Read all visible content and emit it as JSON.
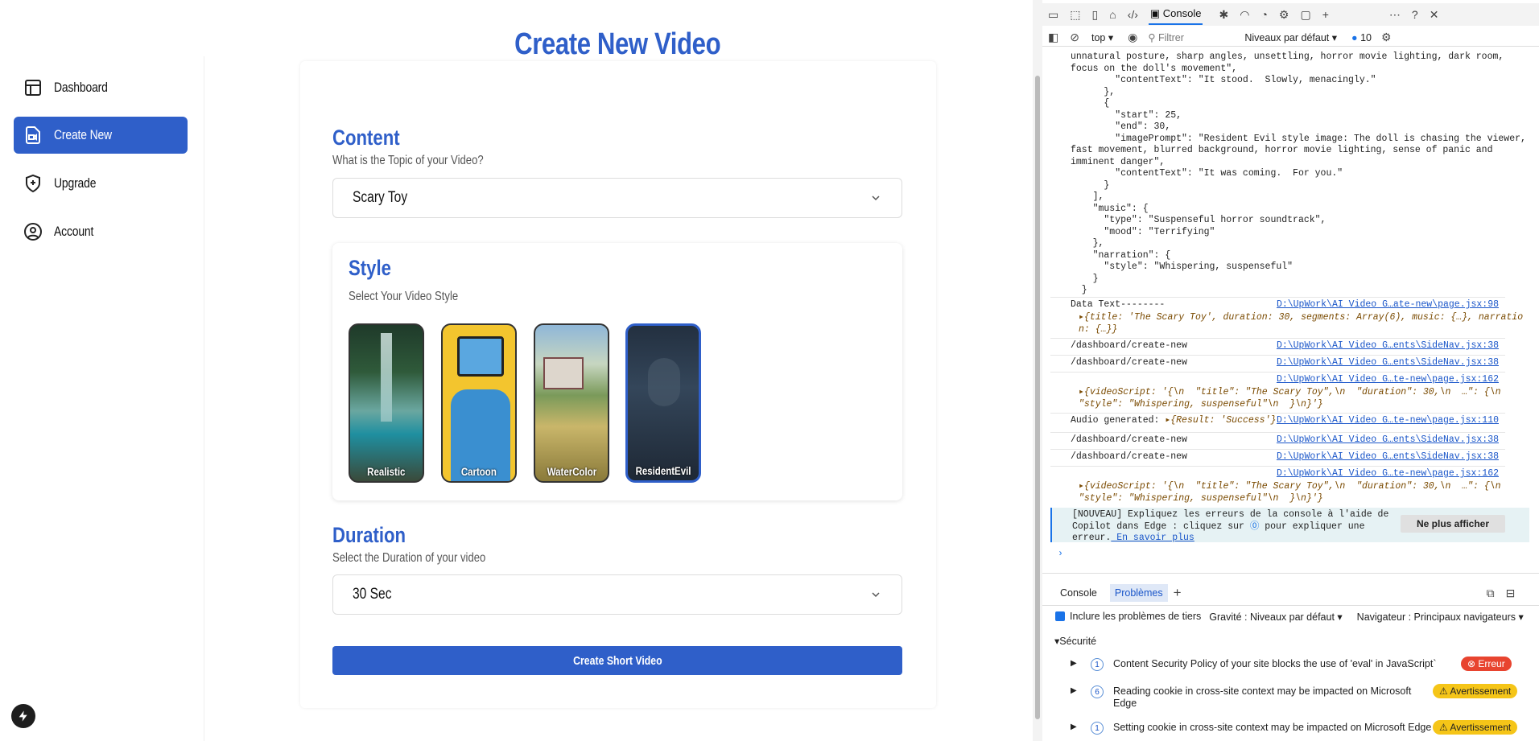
{
  "sidebar": {
    "items": [
      {
        "label": "Dashboard",
        "icon": "layout-icon"
      },
      {
        "label": "Create New",
        "icon": "file-video-icon"
      },
      {
        "label": "Upgrade",
        "icon": "shield-plus-icon"
      },
      {
        "label": "Account",
        "icon": "user-circle-icon"
      }
    ]
  },
  "page": {
    "title": "Create New Video",
    "content_heading": "Content",
    "content_sub": "What is the Topic of your Video?",
    "topic_value": "Scary Toy",
    "style_heading": "Style",
    "style_sub": "Select Your Video Style",
    "styles": [
      {
        "label": "Realistic"
      },
      {
        "label": "Cartoon"
      },
      {
        "label": "WaterColor"
      },
      {
        "label": "ResidentEvil"
      }
    ],
    "duration_heading": "Duration",
    "duration_sub": "Select the Duration of your video",
    "duration_value": "30 Sec",
    "create_button": "Create Short Video"
  },
  "devtools": {
    "tabs": {
      "console": "Console"
    },
    "toolbar": {
      "context": "top",
      "filter_placeholder": "Filtrer",
      "levels": "Niveaux par défaut",
      "issue_count": "10"
    },
    "code_lines": [
      "unnatural posture, sharp angles, unsettling, horror movie lighting, dark room,",
      "focus on the doll's movement\",",
      "        \"contentText\": \"It stood.  Slowly, menacingly.\"",
      "      },",
      "      {",
      "        \"start\": 25,",
      "        \"end\": 30,",
      "        \"imagePrompt\": \"Resident Evil style image: The doll is chasing the viewer,",
      "fast movement, blurred background, horror movie lighting, sense of panic and",
      "imminent danger\",",
      "        \"contentText\": \"It was coming.  For you.\"",
      "      }",
      "    ],",
      "    \"music\": {",
      "      \"type\": \"Suspenseful horror soundtrack\",",
      "      \"mood\": \"Terrifying\"",
      "    },",
      "    \"narration\": {",
      "      \"style\": \"Whispering, suspenseful\"",
      "    }",
      "  }"
    ],
    "logs": [
      {
        "text": "Data Text--------",
        "link": "D:\\UpWork\\AI Video G…ate-new\\page.jsx:98"
      },
      {
        "text": "{title: 'The Scary Toy', duration: 30, segments: Array(6), music: {…}, narratio",
        "text2": "n: {…}}"
      },
      {
        "text": "/dashboard/create-new",
        "link": "D:\\UpWork\\AI Video G…ents\\SideNav.jsx:38"
      },
      {
        "text": "/dashboard/create-new",
        "link": "D:\\UpWork\\AI Video G…ents\\SideNav.jsx:38"
      },
      {
        "link": "D:\\UpWork\\AI Video G…te-new\\page.jsx:162"
      },
      {
        "text": "{videoScript: '{\\n  \"title\": \"The Scary Toy\",\\n  \"duration\": 30,\\n  …\": {\\n",
        "text2": "\"style\": \"Whispering, suspenseful\"\\n  }\\n}'}"
      },
      {
        "text": "Audio generated: ",
        "obj": "{Result: 'Success'}",
        "link": "D:\\UpWork\\AI Video G…te-new\\page.jsx:110"
      },
      {
        "text": "/dashboard/create-new",
        "link": "D:\\UpWork\\AI Video G…ents\\SideNav.jsx:38"
      },
      {
        "text": "/dashboard/create-new",
        "link": "D:\\UpWork\\AI Video G…ents\\SideNav.jsx:38"
      },
      {
        "link": "D:\\UpWork\\AI Video G…te-new\\page.jsx:162"
      },
      {
        "text": "{videoScript: '{\\n  \"title\": \"The Scary Toy\",\\n  \"duration\": 30,\\n  …\": {\\n",
        "text2": "\"style\": \"Whispering, suspenseful\"\\n  }\\n}'}"
      }
    ],
    "copilot": {
      "line1": "[NOUVEAU] Expliquez les erreurs de la console à l'aide de",
      "line2": "Copilot dans Edge : cliquez sur",
      "line2b": " pour expliquer une",
      "line3": "erreur.",
      "link": " En savoir plus",
      "button": "Ne plus afficher"
    },
    "bottom_tabs": {
      "console": "Console",
      "problems": "Problèmes"
    },
    "problems": {
      "include_third_party": "Inclure les problèmes de tiers",
      "severity": "Gravité : Niveaux par défaut",
      "browser": "Navigateur : Principaux navigateurs",
      "section": "Sécurité",
      "items": [
        {
          "count": "1",
          "text": "Content Security Policy of your site blocks the use of 'eval' in JavaScript`",
          "badge": "Erreur"
        },
        {
          "count": "6",
          "text": "Reading cookie in cross-site context may be impacted on Microsoft",
          "text2": "Edge",
          "badge": "Avertissement"
        },
        {
          "count": "1",
          "text": "Setting cookie in cross-site context may be impacted on Microsoft Edge",
          "badge": "Avertissement"
        }
      ]
    }
  }
}
